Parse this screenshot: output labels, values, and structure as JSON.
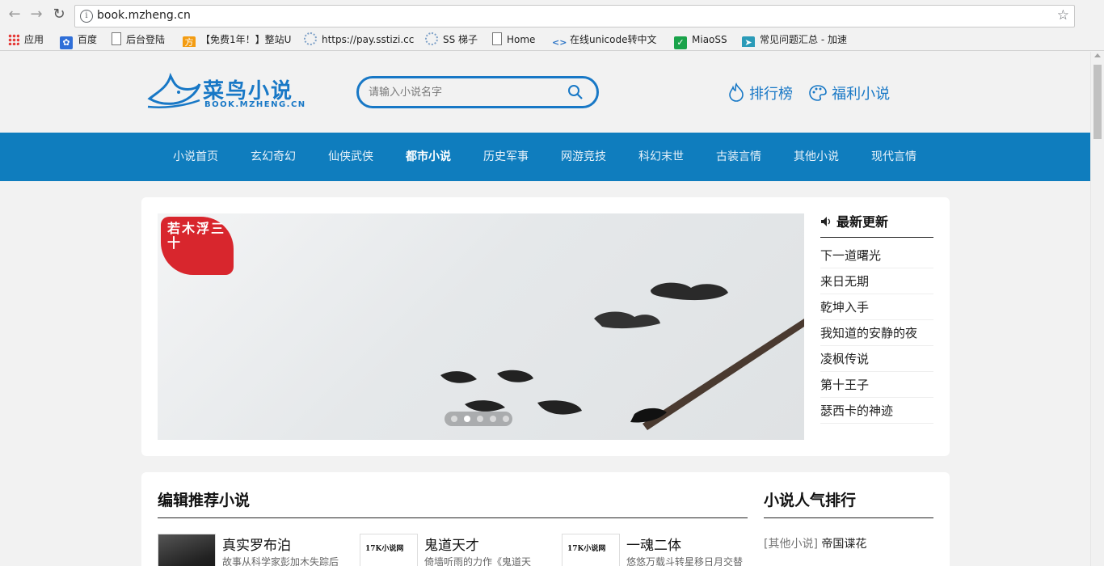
{
  "browser": {
    "url": "book.mzheng.cn",
    "bookmarks": [
      {
        "label": "应用",
        "icon": "apps-grid-icon"
      },
      {
        "label": "百度",
        "icon": "baidu-paw-icon"
      },
      {
        "label": "后台登陆",
        "icon": "page-icon"
      },
      {
        "label": "【免费1年！】整站U",
        "icon": "fang-icon"
      },
      {
        "label": "https://pay.sstizi.cc",
        "icon": "loading-icon"
      },
      {
        "label": "SS 梯子",
        "icon": "loading-icon"
      },
      {
        "label": "Home",
        "icon": "page-icon"
      },
      {
        "label": "在线unicode转中文",
        "icon": "code-icon"
      },
      {
        "label": "MiaoSS",
        "icon": "check-icon"
      },
      {
        "label": "常见问题汇总 - 加速",
        "icon": "rocket-icon"
      }
    ]
  },
  "site": {
    "logo_text": "菜鸟小说",
    "logo_sub": "BOOK.MZHENG.CN",
    "search_placeholder": "请输入小说名字",
    "header_links": [
      {
        "label": "排行榜",
        "icon": "flame-icon"
      },
      {
        "label": "福利小说",
        "icon": "palette-icon"
      }
    ],
    "nav": [
      {
        "label": "小说首页",
        "active": false
      },
      {
        "label": "玄幻奇幻",
        "active": false
      },
      {
        "label": "仙侠武侠",
        "active": false
      },
      {
        "label": "都市小说",
        "active": true
      },
      {
        "label": "历史军事",
        "active": false
      },
      {
        "label": "网游竞技",
        "active": false
      },
      {
        "label": "科幻末世",
        "active": false
      },
      {
        "label": "古装言情",
        "active": false
      },
      {
        "label": "其他小说",
        "active": false
      },
      {
        "label": "现代言情",
        "active": false
      }
    ],
    "slider": {
      "seal_text": "若木浮三十",
      "active_dot": 1,
      "dot_count": 5
    },
    "latest": {
      "title": "最新更新",
      "items": [
        "下一道曙光",
        "来日无期",
        "乾坤入手",
        "我知道的安静的夜",
        "凌枫传说",
        "第十王子",
        "瑟西卡的神迹"
      ]
    },
    "recommend": {
      "title": "编辑推荐小说",
      "books": [
        {
          "name": "真实罗布泊",
          "desc": "故事从科学家彭加木失踪后",
          "cover_title": ""
        },
        {
          "name": "鬼道天才",
          "desc": "倚墙听雨的力作《鬼道天",
          "cover_title": "17K小说网"
        },
        {
          "name": "一魂二体",
          "desc": "悠悠万载斗转星移日月交替",
          "cover_title": "17K小说网"
        }
      ]
    },
    "ranking": {
      "title": "小说人气排行",
      "items": [
        {
          "category": "[其他小说]",
          "name": "帝国谍花"
        }
      ]
    }
  },
  "colors": {
    "brand": "#1878c6",
    "nav_bg": "#0f7dbe"
  }
}
